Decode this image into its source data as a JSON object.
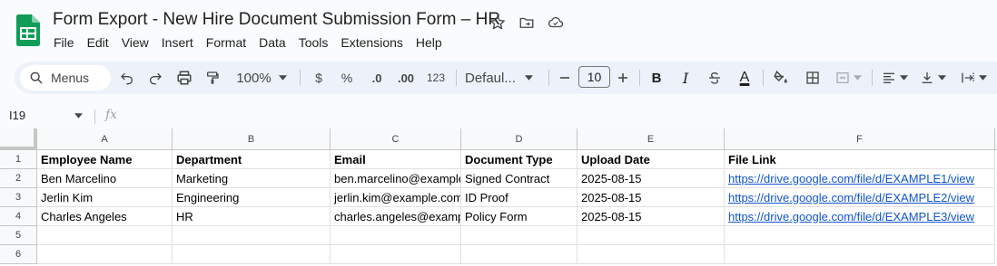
{
  "app": {
    "doc_title": "Form Export - New Hire Document Submission Form – HR",
    "brand_color": "#0f9d58",
    "title_icons": [
      "star-icon",
      "move-to-folder-icon",
      "cloud-status-icon"
    ]
  },
  "menu": [
    "File",
    "Edit",
    "View",
    "Insert",
    "Format",
    "Data",
    "Tools",
    "Extensions",
    "Help"
  ],
  "toolbar": {
    "search_label": "Menus",
    "zoom": "100%",
    "currency": "$",
    "percent": "%",
    "decrease_decimal": ".0",
    "increase_decimal": ".00",
    "number_format": "123",
    "font_name": "Defaul...",
    "font_size": "10",
    "bold": "B",
    "italic": "I",
    "text_color_letter": "A"
  },
  "formula_bar": {
    "name_box": "I19",
    "fx": "fx",
    "content": ""
  },
  "grid": {
    "column_letters": [
      "A",
      "B",
      "C",
      "D",
      "E",
      "F"
    ],
    "row_numbers": [
      "1",
      "2",
      "3",
      "4",
      "5",
      "6"
    ],
    "headers": [
      "Employee Name",
      "Department",
      "Email",
      "Document Type",
      "Upload Date",
      "File Link"
    ],
    "rows": [
      [
        "Ben Marcelino",
        "Marketing",
        "ben.marcelino@example.com",
        "Signed Contract",
        "2025-08-15",
        "https://drive.google.com/file/d/EXAMPLE1/view"
      ],
      [
        "Jerlin Kim",
        "Engineering",
        "jerlin.kim@example.com",
        "ID Proof",
        "2025-08-15",
        "https://drive.google.com/file/d/EXAMPLE2/view"
      ],
      [
        "Charles Angeles",
        "HR",
        "charles.angeles@example.com",
        "Policy Form",
        "2025-08-15",
        "https://drive.google.com/file/d/EXAMPLE3/view"
      ],
      [
        "",
        "",
        "",
        "",
        "",
        ""
      ],
      [
        "",
        "",
        "",
        "",
        "",
        ""
      ]
    ],
    "link_color": "#1155cc"
  }
}
